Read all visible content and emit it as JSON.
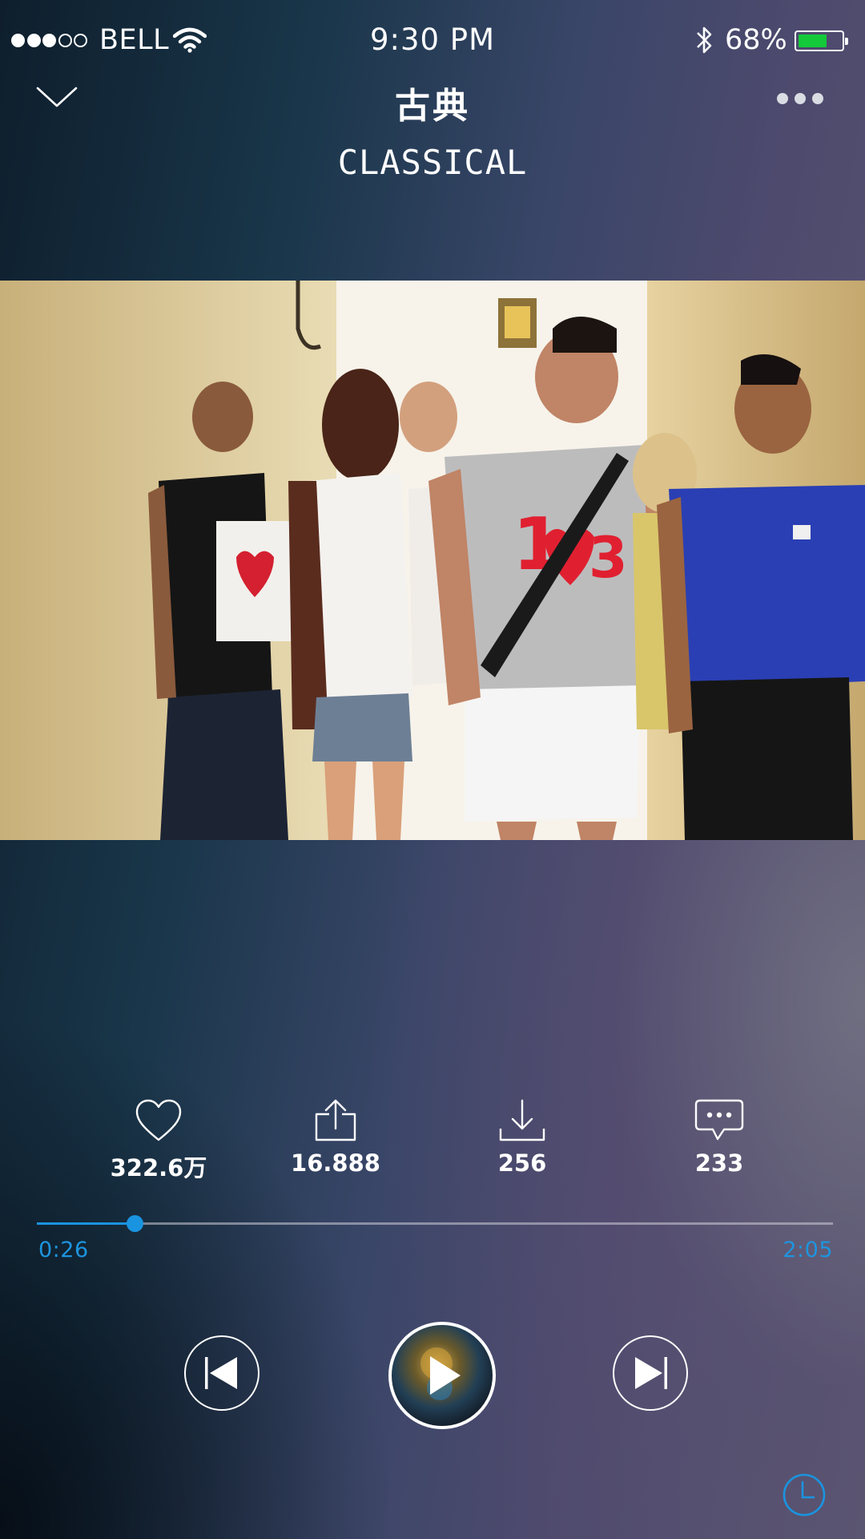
{
  "status_bar": {
    "signal_strength": 3,
    "signal_max": 5,
    "carrier": "BELL",
    "time": "9:30 PM",
    "battery_percent_label": "68%",
    "battery_level": 0.68,
    "battery_color": "#14c93a"
  },
  "header": {
    "title_cn": "古典",
    "title_en": "CLASSICAL",
    "collapse_icon": "chevron-down-icon",
    "more_icon": "more-dots-icon"
  },
  "artwork": {
    "description_icon": "album-cover-photo"
  },
  "actions": [
    {
      "id": "like",
      "icon": "heart-icon",
      "count": "322.6万"
    },
    {
      "id": "share",
      "icon": "share-icon",
      "count": "16.888"
    },
    {
      "id": "download",
      "icon": "download-icon",
      "count": "256"
    },
    {
      "id": "comment",
      "icon": "comment-icon",
      "count": "233"
    }
  ],
  "progress": {
    "elapsed": "0:26",
    "total": "2:05",
    "fraction": 0.123,
    "accent_color": "#1a94e0"
  },
  "controls": {
    "prev_icon": "skip-previous-icon",
    "play_icon": "play-icon",
    "next_icon": "skip-next-icon",
    "timer_icon": "clock-icon"
  }
}
